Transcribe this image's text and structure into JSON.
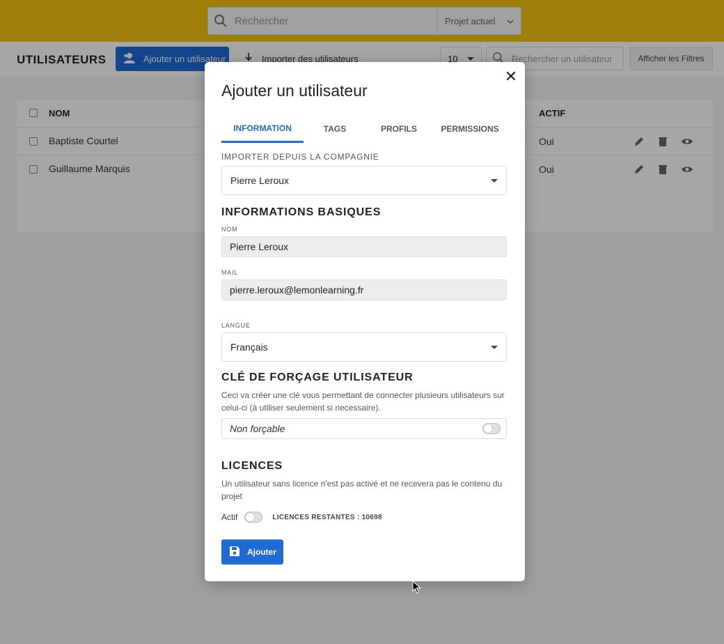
{
  "topbar": {
    "search_placeholder": "Rechercher",
    "project_select": "Projet actuel"
  },
  "header": {
    "title": "UTILISATEURS",
    "add_user_label": "Ajouter un utilisateur",
    "import_label": "Importer des utilisateurs",
    "page_size": "10",
    "search_placeholder": "Rechercher un utilisateur",
    "filters_label": "Afficher les Filtres"
  },
  "table": {
    "columns": {
      "name": "NOM",
      "active": "ACTIF"
    },
    "rows": [
      {
        "name": "Baptiste Courtel",
        "active": "Oui"
      },
      {
        "name": "Guillaume Marquis",
        "active": "Oui"
      }
    ]
  },
  "modal": {
    "title": "Ajouter un utilisateur",
    "close_glyph": "✕",
    "tabs": [
      "INFORMATION",
      "TAGS",
      "PROFILS",
      "PERMISSIONS"
    ],
    "active_tab": "INFORMATION",
    "import_label": "IMPORTER DEPUIS LA COMPAGNIE",
    "import_value": "Pierre Leroux",
    "basic_heading": "INFORMATIONS BASIQUES",
    "name_label": "NOM",
    "name_value": "Pierre Leroux",
    "mail_label": "MAIL",
    "mail_value": "pierre.leroux@lemonlearning.fr",
    "language_label": "LANGUE",
    "language_value": "Français",
    "force_key_heading": "CLÉ DE FORÇAGE UTILISATEUR",
    "force_key_desc": "Ceci va créer une clé vous permettant de connecter plusieurs utilisateurs sur celui-ci (à utiliser seulement si necessaire).",
    "force_key_toggle_label": "Non forçable",
    "force_key_on": false,
    "licences_heading": "LICENCES",
    "licences_desc": "Un utilisateur sans licence n'est pas activé et ne recevera pas le contenu du projet",
    "active_label": "Actif",
    "active_on": false,
    "licences_remaining": "LICENCES RESTANTES : 10698",
    "submit_label": "Ajouter"
  },
  "colors": {
    "topbar": "#f1c40f",
    "primary": "#1e6bd6"
  }
}
